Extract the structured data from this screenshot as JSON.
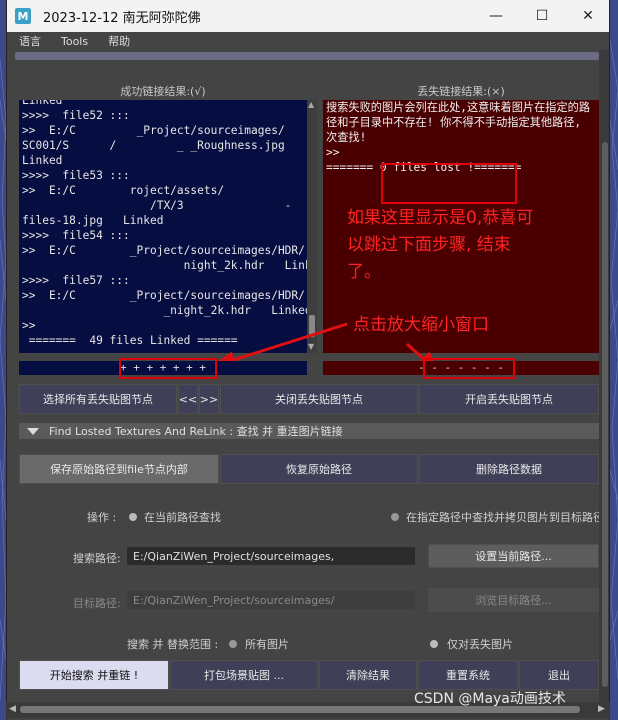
{
  "window": {
    "title": "2023-12-12  南无阿弥陀佛",
    "app_icon_letter": "M",
    "minimize": "—",
    "maximize": "☐",
    "close": "✕"
  },
  "menu": [
    "语言",
    "Tools",
    "帮助"
  ],
  "linked_header": "成功链接结果:(√)",
  "lost_header": "丢失链接结果:(×)",
  "linked_lines": [
    "Linked",
    ">>>>  file52 :::",
    ">>  E:/C         _Project/sourceimages/",
    "SC001/S      /         _ _Roughness.jpg",
    "Linked",
    ">>>>  file53 :::",
    ">>  E:/C        roject/assets/",
    "                   /TX/3               -",
    "files-18.jpg   Linked",
    ">>>>  file54 :::",
    ">>  E:/C        _Project/sourceimages/HDR/",
    "                        night_2k.hdr   Linked",
    ">>>>  file57 :::",
    ">>  E:/C        _Project/sourceimages/HDR/",
    "                     _night_2k.hdr   Linked",
    ">>",
    " =======  49 files Linked ======"
  ],
  "lost_lines": [
    "搜索失败的图片会列在此处,这意味着图片在指定的路",
    "径和子目录中不存在! 你不得不手动指定其他路径,",
    "次查找!",
    ">>",
    " =======   0 files lost !======="
  ],
  "annotation_zero": [
    "如果这里显示是0,恭喜可",
    "以跳过下面步骤, 结束",
    "了。"
  ],
  "annotation_click": "点击放大缩小窗口",
  "zoom_left": "+ + + + + + +",
  "zoom_right": "- - - - - - -",
  "row1": {
    "select_lost": "选择所有丢失贴图节点",
    "prev": "<<",
    "next": ">>",
    "close_lost": "关闭丢失贴图节点",
    "open_lost": "开启丢失贴图节点"
  },
  "section_title": "Find Losted Textures  And  ReLink : 查找 并 重连图片链接",
  "row2": {
    "save_path": "保存原始路径到file节点内部",
    "restore_path": "恢复原始路径",
    "delete_path": "删除路径数据"
  },
  "operation": {
    "label": "操作 :",
    "opt1": "在当前路径查找",
    "opt2": "在指定路径中查找并拷贝图片到目标路径"
  },
  "search": {
    "label": "搜索路径:",
    "value": "E:/QianZiWen_Project/sourceimages,",
    "button": "设置当前路径..."
  },
  "target": {
    "label": "目标路径:",
    "value": "E:/QianZiWen_Project/sourceimages/",
    "button": "浏览目标路径..."
  },
  "scope": {
    "label": "搜索 并 替换范围 :",
    "opt1": "所有图片",
    "opt2": "仅对丢失图片"
  },
  "bottom": {
    "start": "开始搜索 并重链 !",
    "pack": "打包场景贴图 ...",
    "clear": "清除结果",
    "reset": "重置系统",
    "exit": "退出"
  },
  "watermark": "CSDN @Maya动画技术"
}
